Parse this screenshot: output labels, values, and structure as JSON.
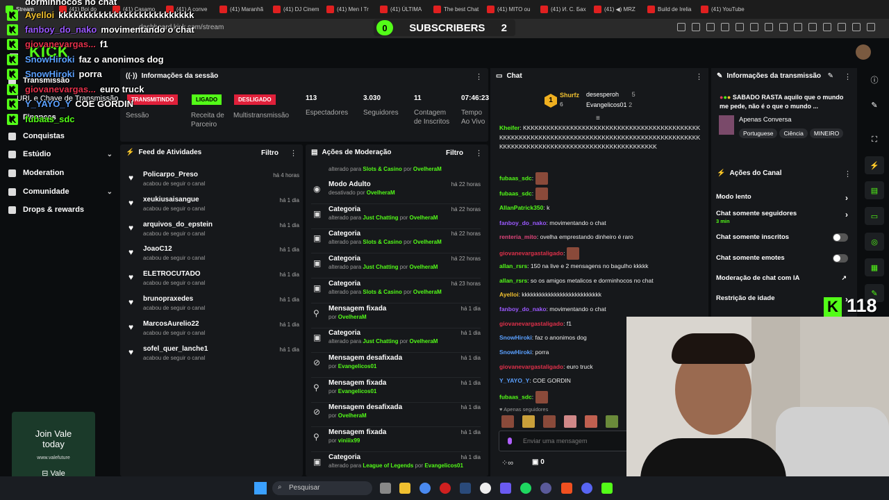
{
  "browser": {
    "tabs": [
      "Stream",
      "(41) Boi do",
      "(41) Casamo",
      "(41) A conve",
      "(41) Maranhã",
      "(41) DJ Cinem",
      "(41) Men I Tr",
      "(41) ÚLTIMA",
      "The best Chat",
      "(41) MITO ou",
      "(41) И. С. Бах",
      "(41) ◀) MRZ",
      "Build de Irelia",
      "(41) YouTube"
    ],
    "url": "dashboard.kick.com/stream"
  },
  "subscribers": {
    "left": "0",
    "label": "SUBSCRIBERS",
    "right": "2"
  },
  "logo": "KICK",
  "sidebar": {
    "items": [
      "Transmissão",
      "URL e Chave de Transmissão",
      "Finanças",
      "Conquistas",
      "Estúdio",
      "Moderation",
      "Comunidade",
      "Drops & rewards"
    ]
  },
  "session": {
    "title": "Informações da sessão",
    "status_live": "TRANSMITINDO",
    "status_partner": "LIGADO",
    "status_multi": "DESLIGADO",
    "labels": [
      "Sessão",
      "Receita de Parceiro",
      "Multistransmissão"
    ],
    "stats": [
      {
        "value": "113",
        "label": "Espectadores"
      },
      {
        "value": "3.030",
        "label": "Seguidores"
      },
      {
        "value": "11",
        "label": "Contagem de Inscritos"
      },
      {
        "value": "07:46:23",
        "label": "Tempo Ao Vivo"
      }
    ]
  },
  "feed": {
    "title": "Feed de Atividades",
    "filter": "Filtro",
    "items": [
      {
        "name": "Policarpo_Preso",
        "sub": "acabou de seguir o canal",
        "time": "há 4 horas"
      },
      {
        "name": "xeukiusaisangue",
        "sub": "acabou de seguir o canal",
        "time": "há 1 dia"
      },
      {
        "name": "arquivos_do_epstein",
        "sub": "acabou de seguir o canal",
        "time": "há 1 dia"
      },
      {
        "name": "JoaoC12",
        "sub": "acabou de seguir o canal",
        "time": "há 1 dia"
      },
      {
        "name": "ELETROCUTADO",
        "sub": "acabou de seguir o canal",
        "time": "há 1 dia"
      },
      {
        "name": "brunopraxedes",
        "sub": "acabou de seguir o canal",
        "time": "há 1 dia"
      },
      {
        "name": "MarcosAurelio22",
        "sub": "acabou de seguir o canal",
        "time": "há 1 dia"
      },
      {
        "name": "sofel_quer_lanche1",
        "sub": "acabou de seguir o canal",
        "time": "há 1 dia"
      }
    ]
  },
  "moderation": {
    "title": "Ações de Moderação",
    "filter": "Filtro",
    "top_line": {
      "pre": "alterado para",
      "val": "Slots & Casino",
      "mid": "por",
      "user": "OvelheraM"
    },
    "items": [
      {
        "title": "Modo Adulto",
        "pre": "desativado por",
        "val": "",
        "mid": "",
        "user": "OvelheraM",
        "time": "há 22 horas",
        "icon": "eye-icon"
      },
      {
        "title": "Categoria",
        "pre": "alterado para",
        "val": "Just Chatting",
        "mid": "por",
        "user": "OvelheraM",
        "time": "há 22 horas",
        "icon": "category-icon"
      },
      {
        "title": "Categoria",
        "pre": "alterado para",
        "val": "Slots & Casino",
        "mid": "por",
        "user": "OvelheraM",
        "time": "há 22 horas",
        "icon": "category-icon"
      },
      {
        "title": "Categoria",
        "pre": "alterado para",
        "val": "Just Chatting",
        "mid": "por",
        "user": "OvelheraM",
        "time": "há 22 horas",
        "icon": "category-icon"
      },
      {
        "title": "Categoria",
        "pre": "alterado para",
        "val": "Slots & Casino",
        "mid": "por",
        "user": "OvelheraM",
        "time": "há 23 horas",
        "icon": "category-icon"
      },
      {
        "title": "Mensagem fixada",
        "pre": "por",
        "val": "",
        "mid": "",
        "user": "OvelheraM",
        "time": "há 1 dia",
        "icon": "pin-icon"
      },
      {
        "title": "Categoria",
        "pre": "alterado para",
        "val": "Just Chatting",
        "mid": "por",
        "user": "OvelheraM",
        "time": "há 1 dia",
        "icon": "category-icon"
      },
      {
        "title": "Mensagem desafixada",
        "pre": "por",
        "val": "",
        "mid": "",
        "user": "Evangelicos01",
        "time": "há 1 dia",
        "icon": "unpin-icon"
      },
      {
        "title": "Mensagem fixada",
        "pre": "por",
        "val": "",
        "mid": "",
        "user": "Evangelicos01",
        "time": "há 1 dia",
        "icon": "pin-icon"
      },
      {
        "title": "Mensagem desafixada",
        "pre": "por",
        "val": "",
        "mid": "",
        "user": "OvelheraM",
        "time": "há 1 dia",
        "icon": "unpin-icon"
      },
      {
        "title": "Mensagem fixada",
        "pre": "por",
        "val": "",
        "mid": "",
        "user": "viniiix99",
        "time": "há 1 dia",
        "icon": "pin-icon"
      },
      {
        "title": "Categoria",
        "pre": "alterado para",
        "val": "League of Legends",
        "mid": "por",
        "user": "Evangelicos01",
        "time": "há 1 dia",
        "icon": "category-icon"
      }
    ]
  },
  "chat": {
    "title": "Chat",
    "top_rank": {
      "rank": "1",
      "name": "Shurfz",
      "count": "6"
    },
    "top_list": [
      {
        "name": "desesperoh",
        "count": "5"
      },
      {
        "name": "Evangelicos01",
        "count": "2"
      }
    ],
    "messages": [
      {
        "user": "Kheifer",
        "color": "#53fc18",
        "text": "KKKKKKKKKKKKKKKKKKKKKKKKKKKKKKKKKKKKKKKKKKKKKKKKKKKKKKKKKKKKKKKKKKKKKKKKKKKKKKKKKKKKKKKKKKKKKKKKKKKKKKKKKKKKKKKKKKKKKKKKKKKKKKKKKKKKKKKK"
      },
      {
        "user": "fubaas_sdc",
        "color": "#53fc18",
        "text": ""
      },
      {
        "user": "fubaas_sdc",
        "color": "#53fc18",
        "text": ""
      },
      {
        "user": "AllanPatrick350",
        "color": "#53fc18",
        "text": "k"
      },
      {
        "user": "fanboy_do_nako",
        "color": "#9b59ff",
        "text": "movimentando o chat"
      },
      {
        "user": "renteria_mito",
        "color": "#e0457b",
        "text": "ovelha emprestando dinheiro é raro"
      },
      {
        "user": "giovanevargastaligado",
        "color": "#e0304a",
        "text": ""
      },
      {
        "user": "allan_rsrs",
        "color": "#53fc18",
        "text": "150 na live e 2 mensagens no bagulho kkkkk"
      },
      {
        "user": "allan_rsrs",
        "color": "#53fc18",
        "text": "so os amigos metalicos e dorminhocos no chat"
      },
      {
        "user": "Ayelloi",
        "color": "#f0c030",
        "text": "kkkkkkkkkkkkkkkkkkkkkkkkkkk"
      },
      {
        "user": "fanboy_do_nako",
        "color": "#9b59ff",
        "text": "movimentando o chat"
      },
      {
        "user": "giovanevargastaligado",
        "color": "#e0304a",
        "text": "f1"
      },
      {
        "user": "SnowHiroki",
        "color": "#5aa0ff",
        "text": "faz o anonimos dog"
      },
      {
        "user": "SnowHiroki",
        "color": "#5aa0ff",
        "text": "porra"
      },
      {
        "user": "giovanevargastaligado",
        "color": "#e0304a",
        "text": "euro truck"
      },
      {
        "user": "Y_YAYO_Y",
        "color": "#5aa0ff",
        "text": "COE GORDIN"
      },
      {
        "user": "fubaas_sdc",
        "color": "#53fc18",
        "text": ""
      }
    ],
    "followers_only": "Apenas seguidores",
    "input_placeholder": "Enviar uma mensagem",
    "footer_count": "0"
  },
  "stream_info": {
    "title": "Informações da transmissão",
    "headline": "SABADO RASTA aquilo que o mundo me pede, não é o que o mundo ...",
    "category": "Apenas Conversa",
    "tags": [
      "Portuguese",
      "Ciência",
      "MINEIRO"
    ]
  },
  "channel_actions": {
    "title": "Ações do Canal",
    "items": [
      {
        "label": "Modo lento",
        "sub": "",
        "kind": "arrow"
      },
      {
        "label": "Chat somente seguidores",
        "sub": "3 min",
        "kind": "arrow"
      },
      {
        "label": "Chat somente inscritos",
        "sub": "",
        "kind": "toggle"
      },
      {
        "label": "Chat somente emotes",
        "sub": "",
        "kind": "toggle"
      },
      {
        "label": "Moderação de chat com IA",
        "sub": "",
        "kind": "ext"
      },
      {
        "label": "Restrição de idade",
        "sub": "",
        "kind": "arrow"
      }
    ]
  },
  "viewer_overlay": "118",
  "overlay_chat": [
    {
      "user": "",
      "text": "dorminhocos no chat",
      "color": "#fff"
    },
    {
      "user": "Ayelloi",
      "text": "kkkkkkkkkkkkkkkkkkkkkkkkkkk",
      "color": "#f0c030"
    },
    {
      "user": "fanboy_do_nako",
      "text": "movimentando o chat",
      "color": "#9b59ff"
    },
    {
      "user": "giovanevargas...",
      "text": "f1",
      "color": "#e0304a"
    },
    {
      "user": "SnowHiroki",
      "text": "faz o anonimos dog",
      "color": "#5aa0ff"
    },
    {
      "user": "SnowHiroki",
      "text": "porra",
      "color": "#5aa0ff"
    },
    {
      "user": "giovanevargas...",
      "text": "euro truck",
      "color": "#e0304a"
    },
    {
      "user": "Y_YAYO_Y",
      "text": "COE GORDIN",
      "color": "#5aa0ff"
    },
    {
      "user": "fubaas_sdc",
      "text": "",
      "color": "#53fc18"
    }
  ],
  "ad": {
    "line1": "Join Vale",
    "line2": "today",
    "line3": "www.valefuture",
    "brand": "Vale"
  },
  "taskbar": {
    "search": "Pesquisar"
  }
}
